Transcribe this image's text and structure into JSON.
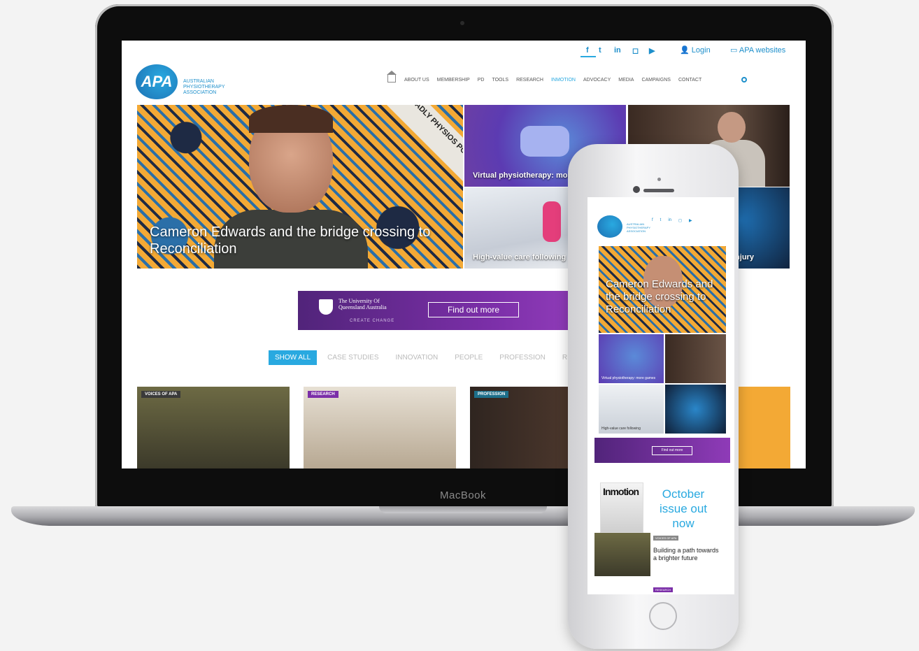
{
  "laptop": {
    "brand_label": "MacBook",
    "site": {
      "top_links": {
        "login": "Login",
        "apa_websites": "APA websites"
      },
      "social_icons": [
        "facebook-icon",
        "twitter-icon",
        "linkedin-icon",
        "instagram-icon",
        "youtube-icon"
      ],
      "logo": {
        "mark": "APA",
        "text": "Australian Physiotherapy Association"
      },
      "nav": [
        "About us",
        "Membership",
        "PD",
        "Tools",
        "Research",
        "InMotion",
        "Advocacy",
        "Media",
        "Campaigns",
        "Contact"
      ],
      "nav_active": "InMotion",
      "hero": {
        "title": "Cameron Edwards and the bridge crossing to Reconciliation",
        "ribbon": "THE DEADLY PHYSIOS PODCAST SHOW"
      },
      "tiles": [
        {
          "caption": "Virtual physiotherapy: more games"
        },
        {
          "caption": "High-value care following"
        },
        {
          "caption": ""
        },
        {
          "caption": "injury"
        }
      ],
      "banner": {
        "university": "The University Of Queensland Australia",
        "tagline": "CREATE CHANGE",
        "button": "Find out more"
      },
      "filters": [
        "Show all",
        "Case studies",
        "Innovation",
        "People",
        "Profession",
        "Rese"
      ],
      "cards": [
        {
          "tag": "Voices of APA"
        },
        {
          "tag": "Research"
        },
        {
          "tag": "Profession"
        }
      ]
    }
  },
  "phone": {
    "hero_title": "Cameron Edwards and the bridge crossing to Reconciliation",
    "banner_button": "Find out more",
    "magazine_title": "Inmotion",
    "magazine_promo": "October issue out now",
    "card": {
      "title": "Building a path towards a brighter future"
    },
    "research_tag": "Research"
  },
  "colors": {
    "accent": "#29a9e0",
    "brand_blue": "#1d8fcb",
    "purple": "#7b2fa8"
  }
}
